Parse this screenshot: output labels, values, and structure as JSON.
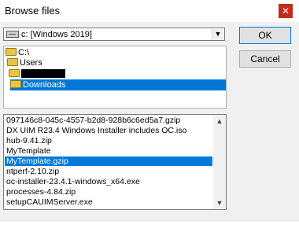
{
  "window": {
    "title": "Browse files",
    "close_icon": "close-icon"
  },
  "drive": {
    "value": "c: [Windows 2019]"
  },
  "buttons": {
    "ok": "OK",
    "cancel": "Cancel"
  },
  "folders": [
    {
      "label": "C:\\",
      "icon": "open-folder-icon"
    },
    {
      "label": "Users",
      "icon": "open-folder-icon"
    },
    {
      "label": "",
      "icon": "open-folder-icon"
    },
    {
      "label": "Downloads",
      "icon": "folder-icon",
      "selected": true
    }
  ],
  "files": [
    "097146c8-045c-4557-b2d8-928b6c6ed5a7.gzip",
    "DX UIM R23.4 Windows Installer includes OC.iso",
    "hub-9.41.zip",
    "MyTemplate",
    "MyTemplate.gzip",
    "ntperf-2.10.zip",
    "oc-installer-23.4.1-windows_x64.exe",
    "processes-4.84.zip",
    "setupCAUIMServer.exe"
  ],
  "selected_file": "MyTemplate.gzip",
  "colors": {
    "selection": "#0078d7",
    "close": "#c42b1c"
  }
}
